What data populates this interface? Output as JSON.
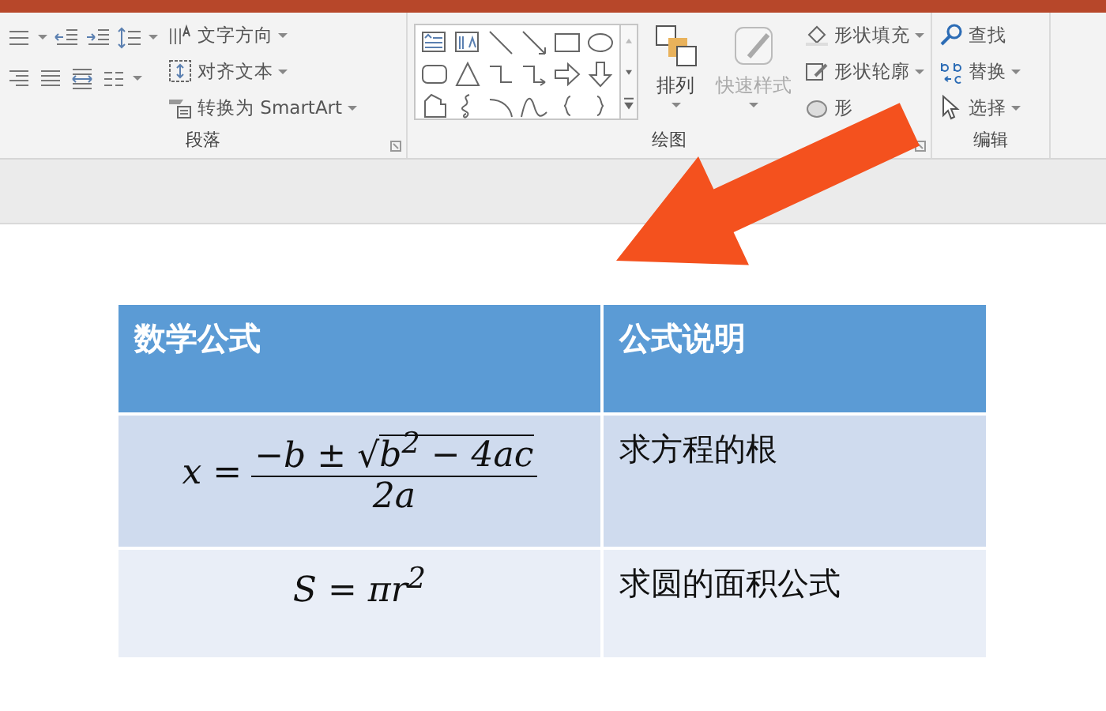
{
  "ribbon": {
    "groups": [
      {
        "kind": "paragraph",
        "label": "段落",
        "commands": [
          {
            "label": "文字方向",
            "dropdown": true
          },
          {
            "label": "对齐文本",
            "dropdown": true
          },
          {
            "label": "转换为 SmartArt",
            "dropdown": true
          }
        ]
      },
      {
        "kind": "drawing",
        "label": "绘图",
        "big_buttons": [
          {
            "label": "排列",
            "disabled": false,
            "dropdown": true
          },
          {
            "label": "快速样式",
            "disabled": true,
            "dropdown": true
          }
        ],
        "commands": [
          {
            "label": "形状填充",
            "dropdown": true
          },
          {
            "label": "形状轮廓",
            "dropdown": true
          },
          {
            "label": "形",
            "dropdown": false
          }
        ]
      },
      {
        "kind": "editing",
        "label": "编辑",
        "commands": [
          {
            "label": "查找",
            "dropdown": false
          },
          {
            "label": "替换",
            "dropdown": true
          },
          {
            "label": "选择",
            "dropdown": true
          }
        ]
      }
    ]
  },
  "table": {
    "columns": [
      "数学公式",
      "公式说明"
    ],
    "rows": [
      {
        "formula": {
          "kind": "fraction",
          "lhs": "x =",
          "numerator": "−b ±",
          "radical": "√",
          "radicand": "b$^{2}$ − 4ac",
          "denominator": "2a"
        },
        "description": "求方程的根"
      },
      {
        "formula": {
          "kind": "inline",
          "text": "S = πr$^{2}$"
        },
        "description": "求圆的面积公式"
      }
    ]
  }
}
